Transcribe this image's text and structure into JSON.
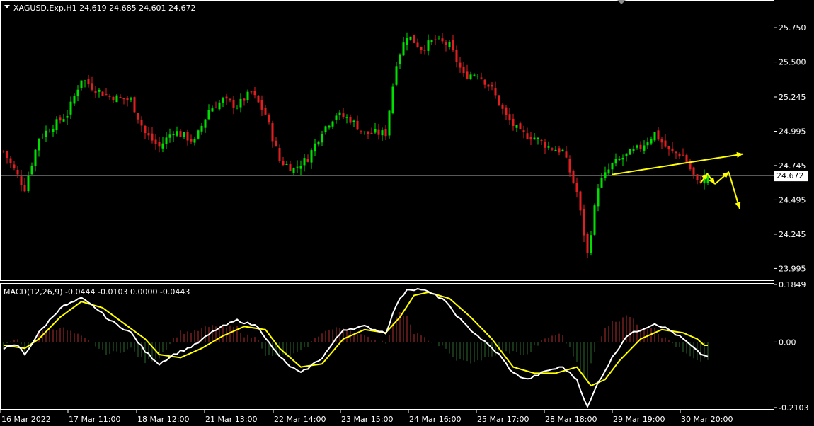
{
  "symbol_header": "XAGUSD.Exp,H1  24.619 24.685 24.601 24.672",
  "macd_header": "MACD(12,26,9) -0.0444 -0.0103 0.0000 -0.0443",
  "current_price_label": "24.672",
  "colors": {
    "background": "#000000",
    "frame": "#ffffff",
    "bull": "#00e000",
    "bear": "#e02020",
    "macd_line": "#ffffff",
    "signal_line": "#ffff00",
    "hist_pos": "#b03030",
    "hist_neg": "#2e6b2e",
    "arrow": "#ffff00",
    "price_line": "#8c8c8c"
  },
  "chart_data": [
    {
      "type": "candlestick",
      "title": "XAGUSD.Exp,H1",
      "ylim": [
        23.93,
        25.9
      ],
      "y_ticks": [
        "25.750",
        "25.500",
        "25.245",
        "24.995",
        "24.745",
        "24.495",
        "24.245",
        "23.995"
      ],
      "x_ticks": [
        "16 Mar 2022",
        "17 Mar 11:00",
        "18 Mar 12:00",
        "21 Mar 13:00",
        "22 Mar 14:00",
        "23 Mar 15:00",
        "24 Mar 16:00",
        "25 Mar 17:00",
        "28 Mar 18:00",
        "29 Mar 19:00",
        "30 Mar 20:00"
      ],
      "bar_count": 200,
      "last_ohlc": {
        "open": 24.619,
        "high": 24.685,
        "low": 24.601,
        "close": 24.672
      },
      "current_price": 24.672,
      "close_path": [
        [
          0,
          24.85
        ],
        [
          6,
          24.58
        ],
        [
          10,
          24.95
        ],
        [
          18,
          25.12
        ],
        [
          22,
          25.38
        ],
        [
          26,
          25.3
        ],
        [
          30,
          25.25
        ],
        [
          36,
          25.22
        ],
        [
          40,
          24.98
        ],
        [
          44,
          24.88
        ],
        [
          48,
          25.0
        ],
        [
          54,
          24.92
        ],
        [
          58,
          25.15
        ],
        [
          62,
          25.22
        ],
        [
          66,
          25.18
        ],
        [
          70,
          25.28
        ],
        [
          74,
          25.12
        ],
        [
          78,
          24.78
        ],
        [
          82,
          24.72
        ],
        [
          86,
          24.8
        ],
        [
          90,
          25.0
        ],
        [
          94,
          25.12
        ],
        [
          98,
          25.08
        ],
        [
          102,
          24.98
        ],
        [
          108,
          24.98
        ],
        [
          111,
          25.5
        ],
        [
          114,
          25.7
        ],
        [
          118,
          25.6
        ],
        [
          122,
          25.66
        ],
        [
          126,
          25.62
        ],
        [
          130,
          25.4
        ],
        [
          134,
          25.42
        ],
        [
          138,
          25.3
        ],
        [
          142,
          25.1
        ],
        [
          146,
          24.98
        ],
        [
          150,
          24.95
        ],
        [
          154,
          24.88
        ],
        [
          158,
          24.85
        ],
        [
          162,
          24.55
        ],
        [
          165,
          24.1
        ],
        [
          168,
          24.6
        ],
        [
          172,
          24.75
        ],
        [
          176,
          24.82
        ],
        [
          180,
          24.88
        ],
        [
          184,
          24.98
        ],
        [
          188,
          24.85
        ],
        [
          192,
          24.82
        ],
        [
          196,
          24.62
        ],
        [
          199,
          24.672
        ]
      ],
      "annotations": [
        {
          "type": "arrow",
          "from": [
            172,
            24.68
          ],
          "to": [
            209,
            24.83
          ]
        },
        {
          "type": "arrow",
          "from": [
            197,
            24.62
          ],
          "to": [
            199,
            24.69
          ]
        },
        {
          "type": "arrow",
          "from": [
            199,
            24.68
          ],
          "to": [
            201,
            24.61
          ]
        },
        {
          "type": "arrow",
          "from": [
            201,
            24.61
          ],
          "to": [
            205,
            24.7
          ]
        },
        {
          "type": "arrow",
          "from": [
            205,
            24.69
          ],
          "to": [
            208,
            24.43
          ]
        }
      ]
    },
    {
      "type": "line",
      "title": "MACD(12,26,9)",
      "ylim": [
        -0.2103,
        0.1849
      ],
      "y_ticks": [
        "0.1849",
        "0.00",
        "-0.2103"
      ],
      "series": [
        {
          "name": "MACD",
          "values": [
            -0.0444
          ]
        },
        {
          "name": "Signal",
          "values": [
            -0.0103
          ]
        }
      ],
      "macd_path": [
        [
          0,
          -0.02
        ],
        [
          4,
          -0.01
        ],
        [
          6,
          -0.04
        ],
        [
          10,
          0.03
        ],
        [
          16,
          0.11
        ],
        [
          22,
          0.14
        ],
        [
          26,
          0.11
        ],
        [
          30,
          0.07
        ],
        [
          36,
          0.03
        ],
        [
          40,
          -0.03
        ],
        [
          44,
          -0.07
        ],
        [
          48,
          -0.04
        ],
        [
          54,
          -0.01
        ],
        [
          60,
          0.04
        ],
        [
          66,
          0.07
        ],
        [
          72,
          0.05
        ],
        [
          76,
          -0.02
        ],
        [
          80,
          -0.07
        ],
        [
          84,
          -0.1
        ],
        [
          90,
          -0.05
        ],
        [
          96,
          0.04
        ],
        [
          102,
          0.05
        ],
        [
          108,
          0.03
        ],
        [
          111,
          0.12
        ],
        [
          114,
          0.17
        ],
        [
          118,
          0.17
        ],
        [
          124,
          0.14
        ],
        [
          130,
          0.06
        ],
        [
          136,
          0.0
        ],
        [
          140,
          -0.04
        ],
        [
          144,
          -0.1
        ],
        [
          148,
          -0.12
        ],
        [
          154,
          -0.09
        ],
        [
          158,
          -0.08
        ],
        [
          162,
          -0.12
        ],
        [
          165,
          -0.21
        ],
        [
          168,
          -0.13
        ],
        [
          172,
          -0.05
        ],
        [
          176,
          0.02
        ],
        [
          180,
          0.04
        ],
        [
          184,
          0.06
        ],
        [
          188,
          0.04
        ],
        [
          192,
          0.01
        ],
        [
          196,
          -0.03
        ],
        [
          198,
          -0.044
        ]
      ],
      "signal_path": [
        [
          0,
          -0.01
        ],
        [
          6,
          -0.02
        ],
        [
          10,
          0.01
        ],
        [
          16,
          0.08
        ],
        [
          22,
          0.13
        ],
        [
          28,
          0.11
        ],
        [
          34,
          0.06
        ],
        [
          40,
          0.01
        ],
        [
          44,
          -0.04
        ],
        [
          50,
          -0.05
        ],
        [
          56,
          -0.02
        ],
        [
          62,
          0.02
        ],
        [
          68,
          0.05
        ],
        [
          74,
          0.04
        ],
        [
          78,
          -0.02
        ],
        [
          84,
          -0.08
        ],
        [
          90,
          -0.07
        ],
        [
          96,
          0.01
        ],
        [
          102,
          0.04
        ],
        [
          108,
          0.03
        ],
        [
          112,
          0.08
        ],
        [
          116,
          0.15
        ],
        [
          120,
          0.16
        ],
        [
          126,
          0.14
        ],
        [
          132,
          0.08
        ],
        [
          138,
          0.01
        ],
        [
          144,
          -0.08
        ],
        [
          150,
          -0.1
        ],
        [
          156,
          -0.1
        ],
        [
          162,
          -0.08
        ],
        [
          166,
          -0.14
        ],
        [
          170,
          -0.12
        ],
        [
          174,
          -0.06
        ],
        [
          180,
          0.01
        ],
        [
          186,
          0.04
        ],
        [
          192,
          0.03
        ],
        [
          196,
          0.01
        ],
        [
          198,
          -0.0103
        ]
      ]
    }
  ]
}
